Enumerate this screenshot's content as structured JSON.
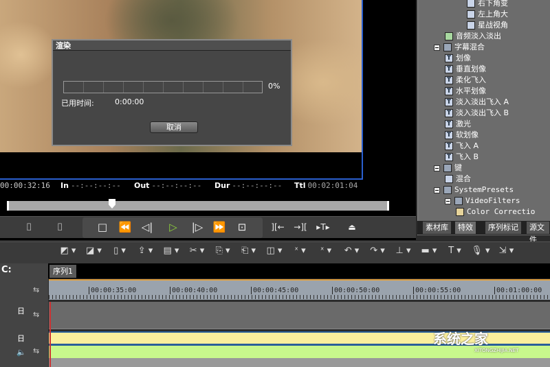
{
  "render_dialog": {
    "title": "渲染",
    "progress_percent": 0,
    "progress_label": "0%",
    "elapsed_label": "已用时间:",
    "elapsed_value": "0:00:00",
    "cancel_label": "取消"
  },
  "player": {
    "current": "00:00:32:16",
    "in_label": "In",
    "in_value": "--:--:--:--",
    "out_label": "Out",
    "out_value": "--:--:--:--",
    "dur_label": "Dur",
    "dur_value": "--:--:--:--",
    "ttl_label": "Ttl",
    "ttl_value": "00:02:01:04",
    "accent": "#2a5fd0",
    "play_color": "#8fd33a"
  },
  "effects_tree": [
    {
      "label": "右下角变",
      "icon": "transition-icon"
    },
    {
      "label": "左上角大",
      "icon": "transition-icon"
    },
    {
      "label": "星战视角",
      "icon": "transition-icon"
    },
    {
      "label": "音频淡入淡出",
      "icon": "audio-folder-icon"
    },
    {
      "label": "字幕混合",
      "icon": "folder-icon"
    },
    {
      "label": "划像",
      "icon": "title-icon"
    },
    {
      "label": "垂直划像",
      "icon": "title-icon"
    },
    {
      "label": "柔化飞入",
      "icon": "title-icon"
    },
    {
      "label": "水平划像",
      "icon": "title-icon"
    },
    {
      "label": "淡入淡出飞入 A",
      "icon": "title-icon"
    },
    {
      "label": "淡入淡出飞入 B",
      "icon": "title-icon"
    },
    {
      "label": "激光",
      "icon": "title-icon"
    },
    {
      "label": "软划像",
      "icon": "title-icon"
    },
    {
      "label": "飞入 A",
      "icon": "title-icon"
    },
    {
      "label": "飞入 B",
      "icon": "title-icon"
    },
    {
      "label": "键",
      "icon": "folder-icon"
    },
    {
      "label": "混合",
      "icon": "transition-icon"
    },
    {
      "label": "SystemPresets",
      "icon": "folder-icon"
    },
    {
      "label": "VideoFilters",
      "icon": "folder-icon"
    },
    {
      "label": "Color Correctio",
      "icon": "filter-icon"
    }
  ],
  "panel_tabs": [
    "素材库",
    "特效",
    "序列标记",
    "源文件"
  ],
  "timeline": {
    "sequence_tab": "序列1",
    "ruler": [
      "00:00:35:00",
      "00:00:40:00",
      "00:00:45:00",
      "00:00:50:00",
      "00:00:55:00",
      "00:01:00:00"
    ],
    "left_label": "C:"
  },
  "watermark": {
    "text": "系统之家",
    "sub": "XITONGZHIJIA.NET"
  }
}
